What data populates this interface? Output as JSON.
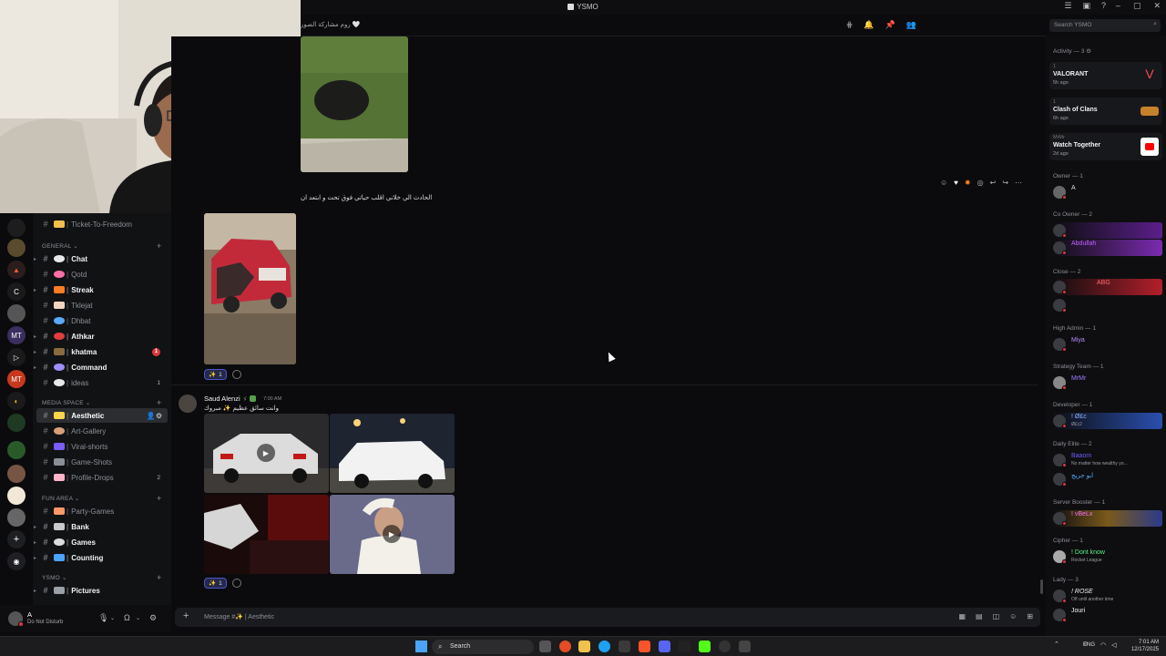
{
  "window": {
    "title": "YSMO",
    "search_placeholder": "Search YSMO"
  },
  "channel_header": {
    "topic": "روم مشاركة الصور 🤍"
  },
  "sidebar": {
    "top_channel": "Ticket-To-Freedom",
    "categories": [
      {
        "name": "GENERAL",
        "channels": [
          {
            "name": "Chat",
            "bold": true
          },
          {
            "name": "Qotd",
            "bold": false
          },
          {
            "name": "Streak",
            "bold": true
          },
          {
            "name": "Tklejat",
            "bold": false
          },
          {
            "name": "Dhbat",
            "bold": false
          },
          {
            "name": "Athkar",
            "bold": true
          },
          {
            "name": "khatma",
            "bold": true,
            "badge": "1"
          },
          {
            "name": "Command",
            "bold": true
          },
          {
            "name": "ideas",
            "bold": false,
            "count": "1"
          }
        ]
      },
      {
        "name": "MEDIA SPACE",
        "channels": [
          {
            "name": "Aesthetic",
            "bold": true,
            "active": true
          },
          {
            "name": "Art-Gallery",
            "bold": false
          },
          {
            "name": "Viral-shorts",
            "bold": false
          },
          {
            "name": "Game-Shots",
            "bold": false
          },
          {
            "name": "Profile-Drops",
            "bold": false,
            "count": "2"
          }
        ]
      },
      {
        "name": "FUN AREA",
        "channels": [
          {
            "name": "Party-Games",
            "bold": false
          },
          {
            "name": "Bank",
            "bold": true
          },
          {
            "name": "Games",
            "bold": true
          },
          {
            "name": "Counting",
            "bold": true
          }
        ]
      },
      {
        "name": "YSMO",
        "channels": [
          {
            "name": "Pictures",
            "bold": true
          }
        ]
      }
    ]
  },
  "user_panel": {
    "name": "A",
    "status": "Do Not Disturb"
  },
  "messages": [
    {
      "text": "الحادث الي خلاني اقلب حياتي فوق تحت و ابتعد ان",
      "reaction_count": "1"
    },
    {
      "author": "Saud Alenzi",
      "author_tag": "ゞ",
      "time": "7:00 AM",
      "text": "وانت سائق عظيم ✨ مبروك",
      "reaction_count": "1"
    }
  ],
  "composer": {
    "placeholder": "Message #✨ | Aesthetic"
  },
  "members": {
    "activity_header": "Activity — 3",
    "activities": [
      {
        "title": "VALORANT",
        "ago": "5h ago"
      },
      {
        "title": "Clash of Clans",
        "ago": "6h ago"
      },
      {
        "small": "MrMr",
        "title": "Watch Together",
        "ago": "2d ago"
      }
    ],
    "roles": [
      {
        "name": "Owner — 1",
        "members": [
          {
            "name": "A",
            "color": "#dbdee1"
          }
        ]
      },
      {
        "name": "Co Owner — 2",
        "members": [
          {
            "name": "",
            "color": "#c061ff"
          },
          {
            "name": "Abdullah",
            "color": "#c061ff"
          }
        ]
      },
      {
        "name": "Close — 2",
        "members": [
          {
            "name": "ABG",
            "color": "#ff6b6b"
          },
          {
            "name": "",
            "color": "#6f5cff"
          }
        ]
      },
      {
        "name": "High Admin — 1",
        "members": [
          {
            "name": "Miya",
            "color": "#b58bff"
          }
        ]
      },
      {
        "name": "Strategy Team — 1",
        "members": [
          {
            "name": "MrMr",
            "color": "#a07cff"
          }
        ]
      },
      {
        "name": "Developer — 1",
        "members": [
          {
            "name": "! Ø£c",
            "sub": "Ø£c2",
            "color": "#8fb6ff"
          }
        ]
      },
      {
        "name": "Daily Elite — 2",
        "members": [
          {
            "name": "Baaom",
            "sub": "No matter how wealthy yo...",
            "color": "#6f5cff"
          },
          {
            "name": "ابو جريج",
            "color": "#4fb0ff"
          }
        ]
      },
      {
        "name": "Server Booster — 1",
        "members": [
          {
            "name": "! vBeLx",
            "color": "#ff73fa"
          }
        ]
      },
      {
        "name": "Cipher — 1",
        "members": [
          {
            "name": "! Dont know",
            "sub": "Rocket League",
            "color": "#57f287"
          }
        ]
      },
      {
        "name": "Lady — 3",
        "members": [
          {
            "name": "! ROSE",
            "sub": "Off until another time",
            "color": "#f2f3f5"
          },
          {
            "name": "Jouri",
            "color": "#f2f3f5"
          }
        ]
      }
    ]
  },
  "taskbar": {
    "search": "Search",
    "lang": "ENG",
    "time": "7:01 AM",
    "date": "12/17/2025"
  },
  "colors": {
    "accent": "#5865f2",
    "background": "#0b0b0d",
    "danger": "#da373c"
  }
}
